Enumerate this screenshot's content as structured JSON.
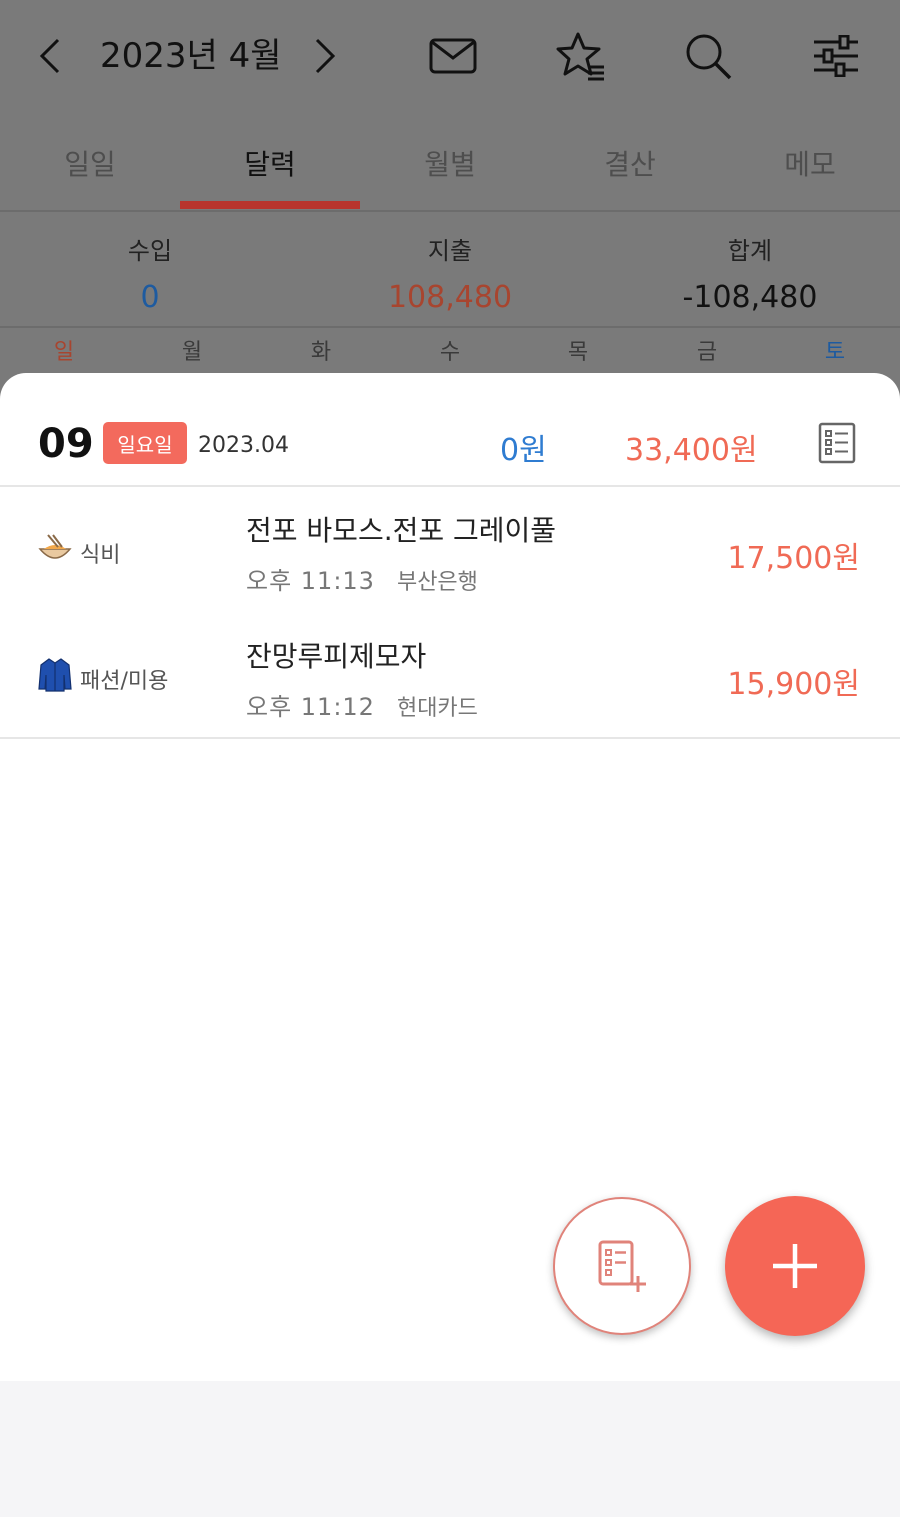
{
  "header": {
    "prev_icon": "chevron-left-icon",
    "month_title": "2023년 4월",
    "next_icon": "chevron-right-icon",
    "icons": [
      "mail-icon",
      "star-list-icon",
      "search-icon",
      "sliders-icon"
    ]
  },
  "tabs": [
    {
      "label": "일일",
      "active": false
    },
    {
      "label": "달력",
      "active": true
    },
    {
      "label": "월별",
      "active": false
    },
    {
      "label": "결산",
      "active": false
    },
    {
      "label": "메모",
      "active": false
    }
  ],
  "summary": {
    "income_label": "수입",
    "income_value": "0",
    "expense_label": "지출",
    "expense_value": "108,480",
    "total_label": "합계",
    "total_value": "-108,480"
  },
  "weekdays": [
    "일",
    "월",
    "화",
    "수",
    "목",
    "금",
    "토"
  ],
  "day_sheet": {
    "day_number": "09",
    "weekday_badge": "일요일",
    "year_month": "2023.04",
    "income": "0원",
    "expense": "33,400원",
    "detail_icon": "list-detail-icon"
  },
  "transactions": [
    {
      "category_icon": "noodle-bowl-icon",
      "category": "식비",
      "title": "전포 바모스.전포 그레이풀",
      "time": "오후 11:13",
      "account": "부산은행",
      "amount": "17,500원"
    },
    {
      "category_icon": "jacket-icon",
      "category": "패션/미용",
      "title": "잔망루피제모자",
      "time": "오후 11:12",
      "account": "현대카드",
      "amount": "15,900원"
    }
  ],
  "fabs": {
    "secondary_icon": "add-list-icon",
    "primary_icon": "plus-icon"
  },
  "colors": {
    "accent": "#f56656",
    "income": "#2f7cd1",
    "expense": "#f06a55",
    "tab_underline": "#b8352d"
  }
}
